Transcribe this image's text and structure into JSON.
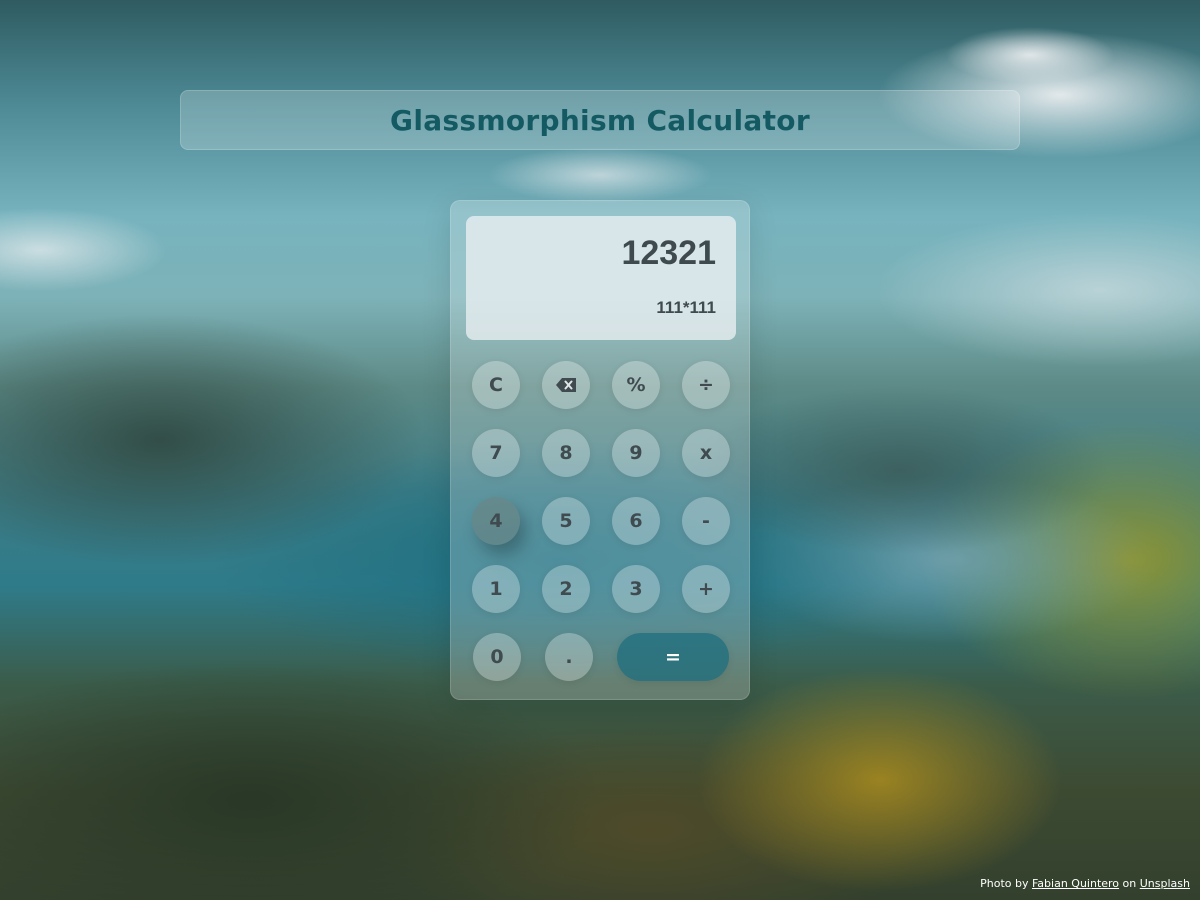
{
  "header": {
    "title": "Glassmorphism Calculator"
  },
  "display": {
    "result": "12321",
    "expression": "111*111"
  },
  "keys": {
    "clear": "C",
    "backspace_icon": "backspace-icon",
    "percent": "%",
    "divide": "÷",
    "seven": "7",
    "eight": "8",
    "nine": "9",
    "multiply": "x",
    "four": "4",
    "five": "5",
    "six": "6",
    "minus": "-",
    "one": "1",
    "two": "2",
    "three": "3",
    "plus": "+",
    "zero": "0",
    "decimal": ".",
    "equals": "="
  },
  "footer": {
    "prefix": "Photo by",
    "author": "Fabian Quintero",
    "middle": "on",
    "site": "Unsplash"
  },
  "colors": {
    "title": "#145a62",
    "equals_button": "#1e6e7d",
    "display_text": "#3e4a4e"
  }
}
